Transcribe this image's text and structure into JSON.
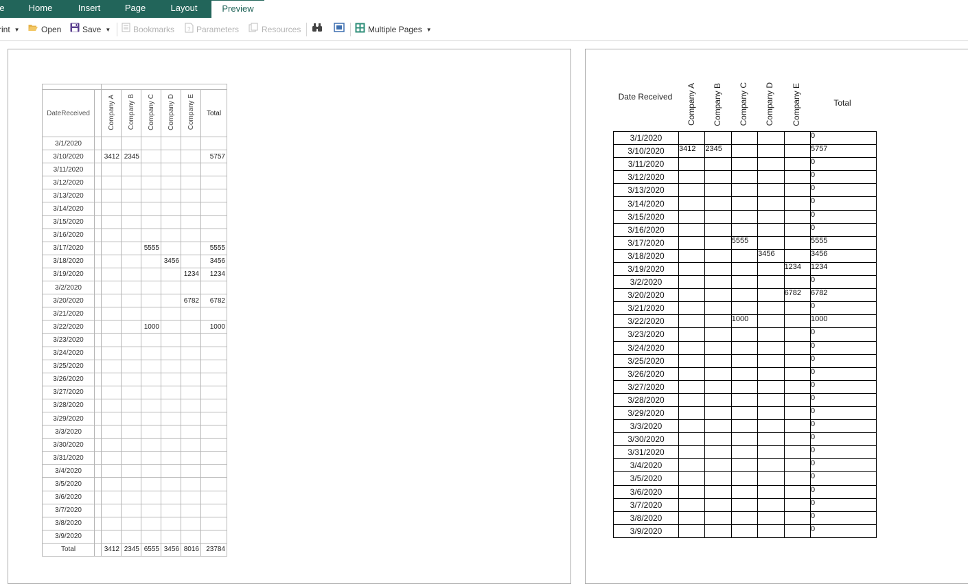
{
  "tabs": [
    {
      "label": "e"
    },
    {
      "label": "Home"
    },
    {
      "label": "Insert"
    },
    {
      "label": "Page"
    },
    {
      "label": "Layout"
    },
    {
      "label": "Preview"
    }
  ],
  "toolbar": {
    "print": "rint",
    "open": "Open",
    "save": "Save",
    "bookmarks": "Bookmarks",
    "parameters": "Parameters",
    "resources": "Resources",
    "multiple_pages": "Multiple Pages"
  },
  "icons": {
    "folder": "folder-open-icon",
    "save": "floppy-disk-icon",
    "bookmarks": "bookmarks-icon",
    "parameters": "parameters-icon",
    "resources": "resources-icon",
    "find": "binoculars-icon",
    "view": "single-page-icon",
    "multiple": "multiple-pages-icon"
  },
  "colors": {
    "ribbon": "#22655a",
    "grid1": "#b5b5b5",
    "grid2": "#000000"
  },
  "page1": {
    "header": {
      "date": "DateReceived",
      "companies": [
        "Company A",
        "Company B",
        "Company C",
        "Company D",
        "Company E"
      ],
      "total": "Total"
    },
    "rows": [
      [
        "3/1/2020",
        "",
        "",
        "",
        "",
        "",
        ""
      ],
      [
        "3/10/2020",
        "3412",
        "2345",
        "",
        "",
        "",
        "5757"
      ],
      [
        "3/11/2020",
        "",
        "",
        "",
        "",
        "",
        ""
      ],
      [
        "3/12/2020",
        "",
        "",
        "",
        "",
        "",
        ""
      ],
      [
        "3/13/2020",
        "",
        "",
        "",
        "",
        "",
        ""
      ],
      [
        "3/14/2020",
        "",
        "",
        "",
        "",
        "",
        ""
      ],
      [
        "3/15/2020",
        "",
        "",
        "",
        "",
        "",
        ""
      ],
      [
        "3/16/2020",
        "",
        "",
        "",
        "",
        "",
        ""
      ],
      [
        "3/17/2020",
        "",
        "",
        "5555",
        "",
        "",
        "5555"
      ],
      [
        "3/18/2020",
        "",
        "",
        "",
        "3456",
        "",
        "3456"
      ],
      [
        "3/19/2020",
        "",
        "",
        "",
        "",
        "1234",
        "1234"
      ],
      [
        "3/2/2020",
        "",
        "",
        "",
        "",
        "",
        ""
      ],
      [
        "3/20/2020",
        "",
        "",
        "",
        "",
        "6782",
        "6782"
      ],
      [
        "3/21/2020",
        "",
        "",
        "",
        "",
        "",
        ""
      ],
      [
        "3/22/2020",
        "",
        "",
        "1000",
        "",
        "",
        "1000"
      ],
      [
        "3/23/2020",
        "",
        "",
        "",
        "",
        "",
        ""
      ],
      [
        "3/24/2020",
        "",
        "",
        "",
        "",
        "",
        ""
      ],
      [
        "3/25/2020",
        "",
        "",
        "",
        "",
        "",
        ""
      ],
      [
        "3/26/2020",
        "",
        "",
        "",
        "",
        "",
        ""
      ],
      [
        "3/27/2020",
        "",
        "",
        "",
        "",
        "",
        ""
      ],
      [
        "3/28/2020",
        "",
        "",
        "",
        "",
        "",
        ""
      ],
      [
        "3/29/2020",
        "",
        "",
        "",
        "",
        "",
        ""
      ],
      [
        "3/3/2020",
        "",
        "",
        "",
        "",
        "",
        ""
      ],
      [
        "3/30/2020",
        "",
        "",
        "",
        "",
        "",
        ""
      ],
      [
        "3/31/2020",
        "",
        "",
        "",
        "",
        "",
        ""
      ],
      [
        "3/4/2020",
        "",
        "",
        "",
        "",
        "",
        ""
      ],
      [
        "3/5/2020",
        "",
        "",
        "",
        "",
        "",
        ""
      ],
      [
        "3/6/2020",
        "",
        "",
        "",
        "",
        "",
        ""
      ],
      [
        "3/7/2020",
        "",
        "",
        "",
        "",
        "",
        ""
      ],
      [
        "3/8/2020",
        "",
        "",
        "",
        "",
        "",
        ""
      ],
      [
        "3/9/2020",
        "",
        "",
        "",
        "",
        "",
        ""
      ]
    ],
    "totals": [
      "Total",
      "3412",
      "2345",
      "6555",
      "3456",
      "8016",
      "23784"
    ]
  },
  "page2": {
    "header": {
      "date": "Date Received",
      "companies": [
        "Company A",
        "Company B",
        "Company C",
        "Company D",
        "Company E"
      ],
      "total": "Total"
    },
    "rows": [
      [
        "3/1/2020",
        "",
        "",
        "",
        "",
        "",
        "0"
      ],
      [
        "3/10/2020",
        "3412",
        "2345",
        "",
        "",
        "",
        "5757"
      ],
      [
        "3/11/2020",
        "",
        "",
        "",
        "",
        "",
        "0"
      ],
      [
        "3/12/2020",
        "",
        "",
        "",
        "",
        "",
        "0"
      ],
      [
        "3/13/2020",
        "",
        "",
        "",
        "",
        "",
        "0"
      ],
      [
        "3/14/2020",
        "",
        "",
        "",
        "",
        "",
        "0"
      ],
      [
        "3/15/2020",
        "",
        "",
        "",
        "",
        "",
        "0"
      ],
      [
        "3/16/2020",
        "",
        "",
        "",
        "",
        "",
        "0"
      ],
      [
        "3/17/2020",
        "",
        "",
        "5555",
        "",
        "",
        "5555"
      ],
      [
        "3/18/2020",
        "",
        "",
        "",
        "3456",
        "",
        "3456"
      ],
      [
        "3/19/2020",
        "",
        "",
        "",
        "",
        "1234",
        "1234"
      ],
      [
        "3/2/2020",
        "",
        "",
        "",
        "",
        "",
        "0"
      ],
      [
        "3/20/2020",
        "",
        "",
        "",
        "",
        "6782",
        "6782"
      ],
      [
        "3/21/2020",
        "",
        "",
        "",
        "",
        "",
        "0"
      ],
      [
        "3/22/2020",
        "",
        "",
        "1000",
        "",
        "",
        "1000"
      ],
      [
        "3/23/2020",
        "",
        "",
        "",
        "",
        "",
        "0"
      ],
      [
        "3/24/2020",
        "",
        "",
        "",
        "",
        "",
        "0"
      ],
      [
        "3/25/2020",
        "",
        "",
        "",
        "",
        "",
        "0"
      ],
      [
        "3/26/2020",
        "",
        "",
        "",
        "",
        "",
        "0"
      ],
      [
        "3/27/2020",
        "",
        "",
        "",
        "",
        "",
        "0"
      ],
      [
        "3/28/2020",
        "",
        "",
        "",
        "",
        "",
        "0"
      ],
      [
        "3/29/2020",
        "",
        "",
        "",
        "",
        "",
        "0"
      ],
      [
        "3/3/2020",
        "",
        "",
        "",
        "",
        "",
        "0"
      ],
      [
        "3/30/2020",
        "",
        "",
        "",
        "",
        "",
        "0"
      ],
      [
        "3/31/2020",
        "",
        "",
        "",
        "",
        "",
        "0"
      ],
      [
        "3/4/2020",
        "",
        "",
        "",
        "",
        "",
        "0"
      ],
      [
        "3/5/2020",
        "",
        "",
        "",
        "",
        "",
        "0"
      ],
      [
        "3/6/2020",
        "",
        "",
        "",
        "",
        "",
        "0"
      ],
      [
        "3/7/2020",
        "",
        "",
        "",
        "",
        "",
        "0"
      ],
      [
        "3/8/2020",
        "",
        "",
        "",
        "",
        "",
        "0"
      ],
      [
        "3/9/2020",
        "",
        "",
        "",
        "",
        "",
        "0"
      ]
    ]
  }
}
